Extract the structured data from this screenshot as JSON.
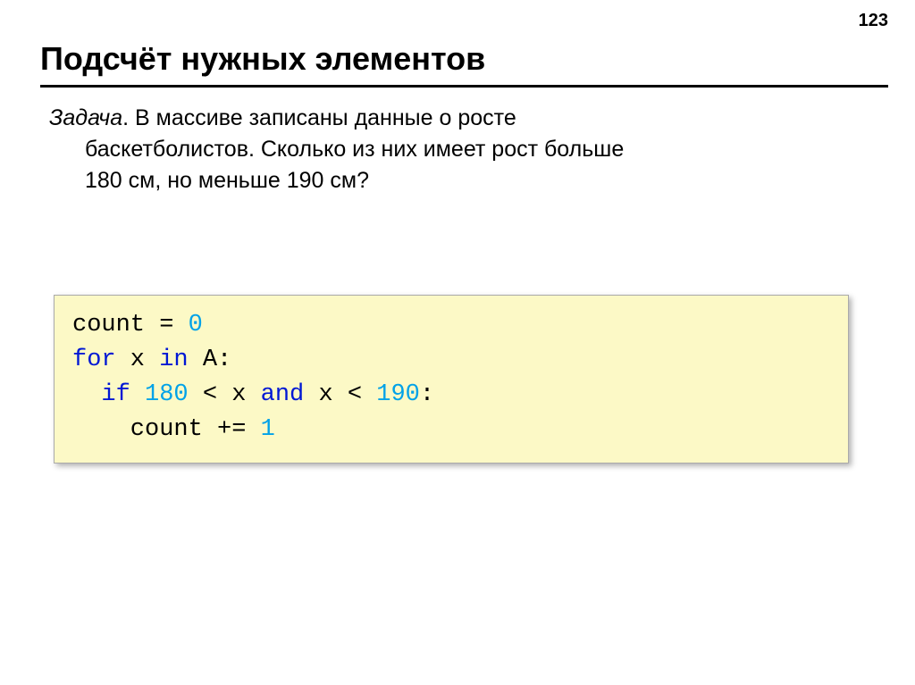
{
  "pageNumber": "123",
  "title": "Подсчёт нужных элементов",
  "task": {
    "label": "Задача",
    "line1": ". В массиве записаны данные о росте",
    "line2": "баскетболистов. Сколько из них имеет рост больше",
    "line3": "180 см, но меньше 190 см?"
  },
  "code": {
    "l1_t1": "count",
    "l1_t2": " = ",
    "l1_t3": "0",
    "l2_t1": "for",
    "l2_t2": " x ",
    "l2_t3": "in",
    "l2_t4": " A:",
    "l3_t1": "  ",
    "l3_t2": "if",
    "l3_t3": " ",
    "l3_t4": "180",
    "l3_t5": " < x ",
    "l3_t6": "and",
    "l3_t7": " x < ",
    "l3_t8": "190",
    "l3_t9": ":",
    "l4_t1": "    count += ",
    "l4_t2": "1"
  }
}
